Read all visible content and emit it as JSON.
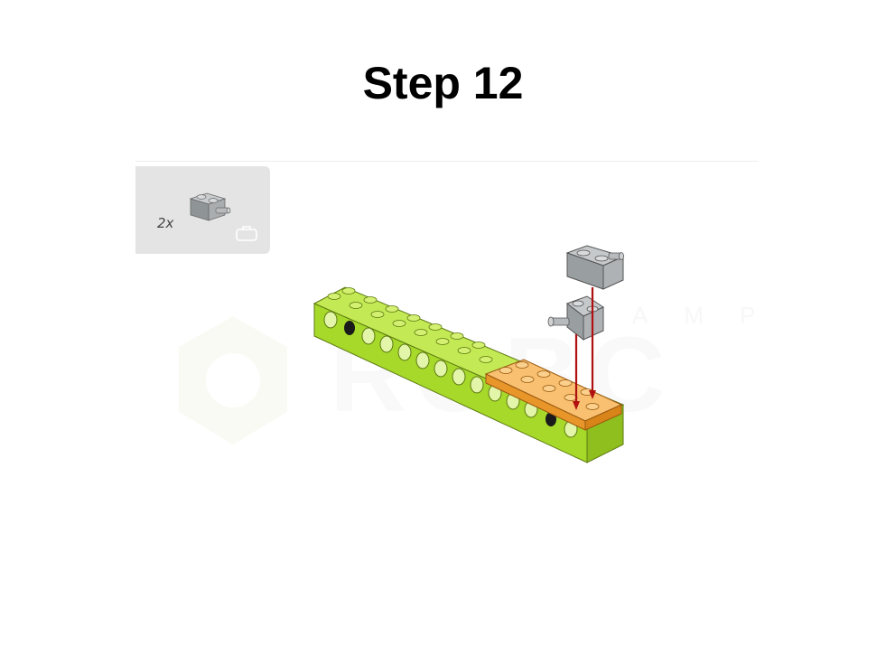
{
  "step": {
    "title": "Step 12"
  },
  "parts_list": {
    "items": [
      {
        "quantity": "2x",
        "part": "light-gray-brick-with-pin-icon"
      }
    ]
  },
  "watermark": {
    "text_top": "AMP",
    "text_main": "ROBC"
  },
  "colors": {
    "lime_beam": "#a6d92a",
    "orange_plate": "#f2a53a",
    "gray_brick": "#9da2a6",
    "arrow_red": "#b01010",
    "panel_bg": "#e4e4e4"
  }
}
